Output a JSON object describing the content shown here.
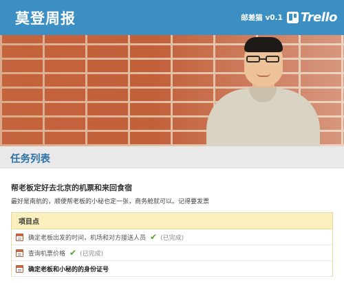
{
  "header": {
    "title": "莫登周报",
    "version": "邮差猫 v0.1",
    "brand": "Trello",
    "background_color": "#3b8fc2"
  },
  "hero": {
    "icon": "photo-of-person-at-brick-wall"
  },
  "section": {
    "title": "任务列表"
  },
  "task": {
    "title": "帮老板定好去北京的机票和来回食宿",
    "description": "最好是南航的，顺便帮老板的小秘也定一张，商务舱就可以。记得要发票",
    "items_header": "项目点",
    "items": [
      {
        "text": "确定老板出发的时间，机场和对方接送人员",
        "done": true,
        "done_label": "(已完成)"
      },
      {
        "text": "查询机票价格",
        "done": true,
        "done_label": "(已完成)"
      },
      {
        "text": "确定老板和小秘的的身份证号",
        "done": false,
        "done_label": ""
      }
    ]
  },
  "colors": {
    "accent": "#3b8fc2",
    "section_title": "#2d73a8",
    "check": "#5aa02c",
    "items_header_bg": "#fbf0bd"
  }
}
